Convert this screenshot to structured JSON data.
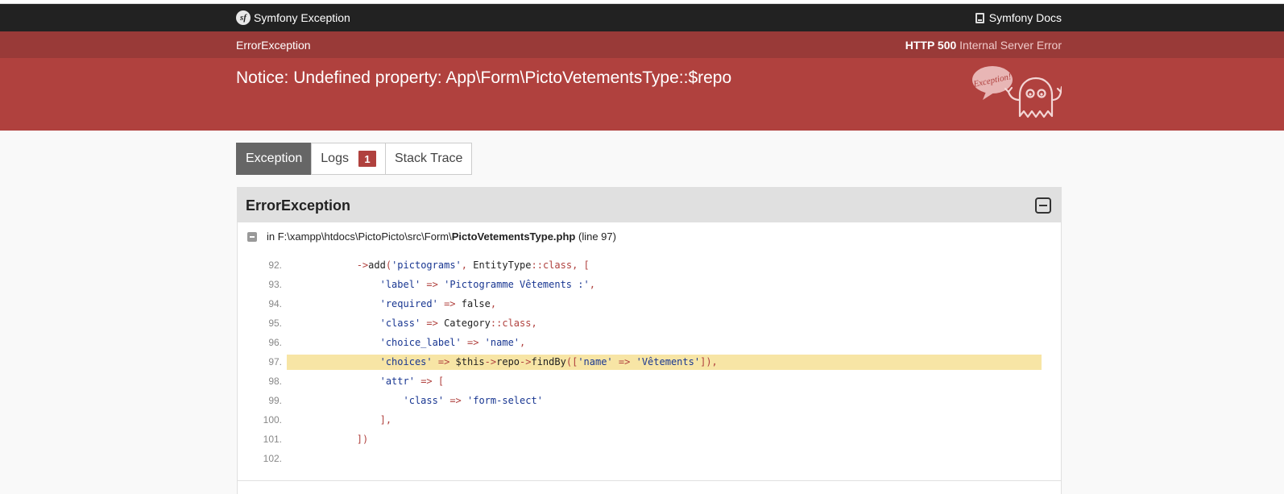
{
  "header": {
    "brand_logo": "sf",
    "brand_label": "Symfony Exception",
    "docs_label": "Symfony Docs"
  },
  "summary": {
    "exception_class": "ErrorException",
    "status_code": "HTTP 500",
    "status_text": "Internal Server Error",
    "message": "Notice: Undefined property: App\\Form\\PictoVetementsType::$repo",
    "ghost_label": "Exception!"
  },
  "tabs": [
    {
      "label": "Exception",
      "active": true
    },
    {
      "label": "Logs",
      "badge": "1"
    },
    {
      "label": "Stack Trace"
    }
  ],
  "panel": {
    "title": "ErrorException",
    "file_prefix": "in F:\\xampp\\htdocs\\PictoPicto\\src\\Form\\",
    "file_name": "PictoVetementsType.php",
    "line_info": "(line 97)"
  },
  "code_lines": [
    {
      "num": "92.",
      "highlighted": false,
      "text": "            ->add('pictograms', EntityType::class, ["
    },
    {
      "num": "93.",
      "highlighted": false,
      "text": "                'label' => 'Pictogramme Vêtements :',"
    },
    {
      "num": "94.",
      "highlighted": false,
      "text": "                'required' => false,"
    },
    {
      "num": "95.",
      "highlighted": false,
      "text": "                'class' => Category::class,"
    },
    {
      "num": "96.",
      "highlighted": false,
      "text": "                'choice_label' => 'name',"
    },
    {
      "num": "97.",
      "highlighted": true,
      "text": "                'choices' => $this->repo->findBy(['name' => 'Vêtements']),"
    },
    {
      "num": "98.",
      "highlighted": false,
      "text": "                'attr' => ["
    },
    {
      "num": "99.",
      "highlighted": false,
      "text": "                    'class' => 'form-select'"
    },
    {
      "num": "100.",
      "highlighted": false,
      "text": "                ],"
    },
    {
      "num": "101.",
      "highlighted": false,
      "text": "            ])"
    },
    {
      "num": "102.",
      "highlighted": false,
      "text": ""
    }
  ],
  "colors": {
    "header_bg": "#222222",
    "status_bar_bg": "#993a38",
    "message_bg": "#b0413e",
    "highlight_line": "#f7e5a5",
    "active_tab": "#666666"
  },
  "icons": {
    "brand": "symfony-logo-icon",
    "docs": "book-icon",
    "toggle": "collapse-minus-icon",
    "ghost": "exception-ghost-icon"
  }
}
